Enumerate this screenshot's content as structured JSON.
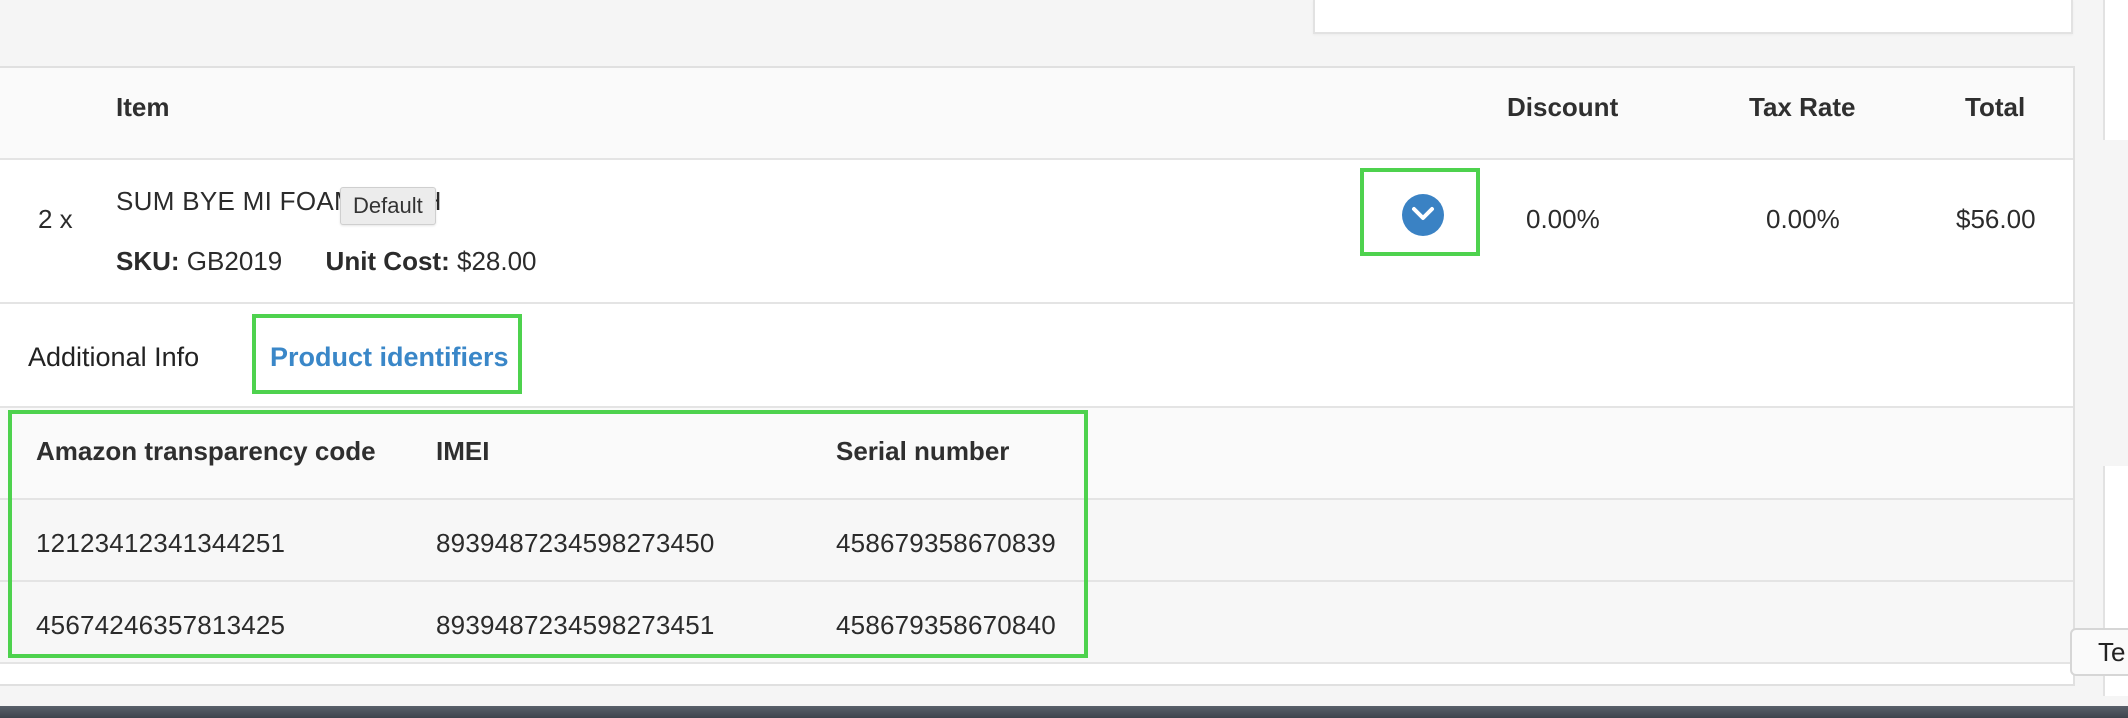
{
  "table_headers": {
    "item": "Item",
    "discount": "Discount",
    "tax_rate": "Tax Rate",
    "total": "Total"
  },
  "line_item": {
    "quantity": "2 x",
    "product_name": "SUM BYE MI FOAM WASH",
    "tooltip": "Default",
    "sku_label": "SKU:",
    "sku_value": "GB2019",
    "unit_cost_label": "Unit Cost:",
    "unit_cost_value": "$28.00",
    "discount": "0.00%",
    "tax_rate": "0.00%",
    "total": "$56.00",
    "expander_icon": "chevron-down-circle-icon"
  },
  "tabs": [
    {
      "label": "Additional Info",
      "active": false
    },
    {
      "label": "Product identifiers",
      "active": true
    }
  ],
  "identifiers": {
    "headers": [
      "Amazon transparency code",
      "IMEI",
      "Serial number"
    ],
    "rows": [
      [
        "12123412341344251",
        "8939487234598273450",
        "458679358670839"
      ],
      [
        "45674246357813425",
        "8939487234598273451",
        "458679358670840"
      ]
    ]
  },
  "side_button": {
    "label": "Te"
  },
  "colors": {
    "accent": "#3a87c8",
    "highlight": "#4ed24e",
    "text": "#2b2b2b"
  }
}
